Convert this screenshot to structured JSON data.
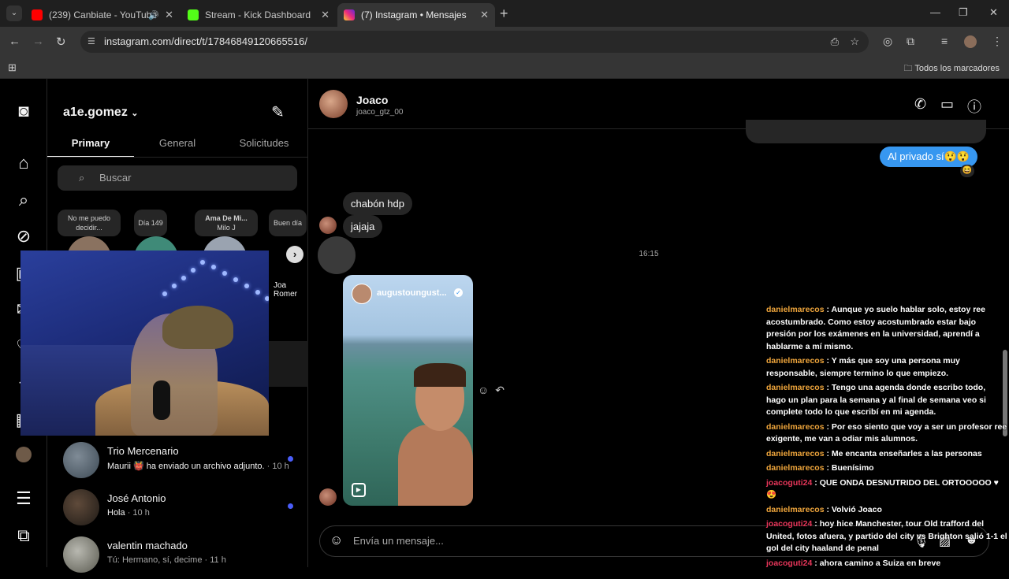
{
  "browser": {
    "tabs": [
      {
        "title": "(239) Canbiate - YouTube",
        "favicon_color": "#ff0000"
      },
      {
        "title": "Stream - Kick Dashboard",
        "favicon_color": "#53fc18"
      },
      {
        "title": "(7) Instagram • Mensajes",
        "favicon_color": "#d6249f"
      }
    ],
    "url": "instagram.com/direct/t/17846849120665516/",
    "bookmarks_label": "Todos los marcadores"
  },
  "inbox": {
    "username": "a1e.gomez",
    "tabs": [
      "Primary",
      "General",
      "Solicitudes"
    ],
    "search_placeholder": "Buscar",
    "notes": [
      {
        "text": "No me puedo decidir..."
      },
      {
        "text": "Día 149"
      },
      {
        "text": "Ama De Mi...",
        "sub": "Milo J"
      },
      {
        "text": "Buen día"
      }
    ],
    "note_name": "Joa Romer",
    "conversations": [
      {
        "name": "Trio Mercenario",
        "preview": "Maurii 👹 ha enviado un archivo adjunto.",
        "time": "· 10 h",
        "unread": true
      },
      {
        "name": "José Antonio",
        "preview": "Hola",
        "time": "· 10 h",
        "unread": true
      },
      {
        "name": "valentin machado",
        "preview": "Tú: Hermano, sí, decime",
        "time": "· 11 h",
        "unread": false
      }
    ]
  },
  "thread": {
    "name": "Joaco",
    "handle": "joaco_gtz_00",
    "outgoing": "Al privado sí😲😲",
    "reaction": "😆",
    "incoming": [
      "chabón hdp",
      "jajaja"
    ],
    "timestamp": "16:15",
    "reel_user": "augustoungust...",
    "composer_placeholder": "Envía un mensaje..."
  },
  "stream_chat": [
    {
      "user": "danielmarecos",
      "text": "Aunque yo suelo hablar solo, estoy ree acostumbrado. Como estoy acostumbrado estar bajo presión por los exámenes en la universidad, aprendí a hablarme a mí mismo.",
      "color": "#f0a63c"
    },
    {
      "user": "danielmarecos",
      "text": "Y más que soy una persona muy responsable, siempre termino lo que empiezo.",
      "color": "#f0a63c"
    },
    {
      "user": "danielmarecos",
      "text": "Tengo una agenda donde escribo todo, hago un plan para la semana y al final de semana veo si complete todo lo que escribí en mi agenda.",
      "color": "#f0a63c"
    },
    {
      "user": "danielmarecos",
      "text": "Por eso siento que voy a ser un profesor ree exigente, me van a odiar mis alumnos.",
      "color": "#f0a63c"
    },
    {
      "user": "danielmarecos",
      "text": "Me encanta enseñarles a las personas",
      "color": "#f0a63c"
    },
    {
      "user": "danielmarecos",
      "text": "Buenísimo",
      "color": "#f0a63c"
    },
    {
      "user": "joacoguti24",
      "text": "QUE ONDA DESNUTRIDO DEL ORTOOOOO ♥😍",
      "color": "#e8365a"
    },
    {
      "user": "danielmarecos",
      "text": "Volvió Joaco",
      "color": "#f0a63c"
    },
    {
      "user": "joacoguti24",
      "text": "hoy hice Manchester, tour Old trafford del United, fotos afuera, y partido del city vs Brighton salió 1-1 el gol del city haaland de penal",
      "color": "#e8365a"
    },
    {
      "user": "joacoguti24",
      "text": "ahora camino a Suiza en breve",
      "color": "#e8365a"
    }
  ]
}
